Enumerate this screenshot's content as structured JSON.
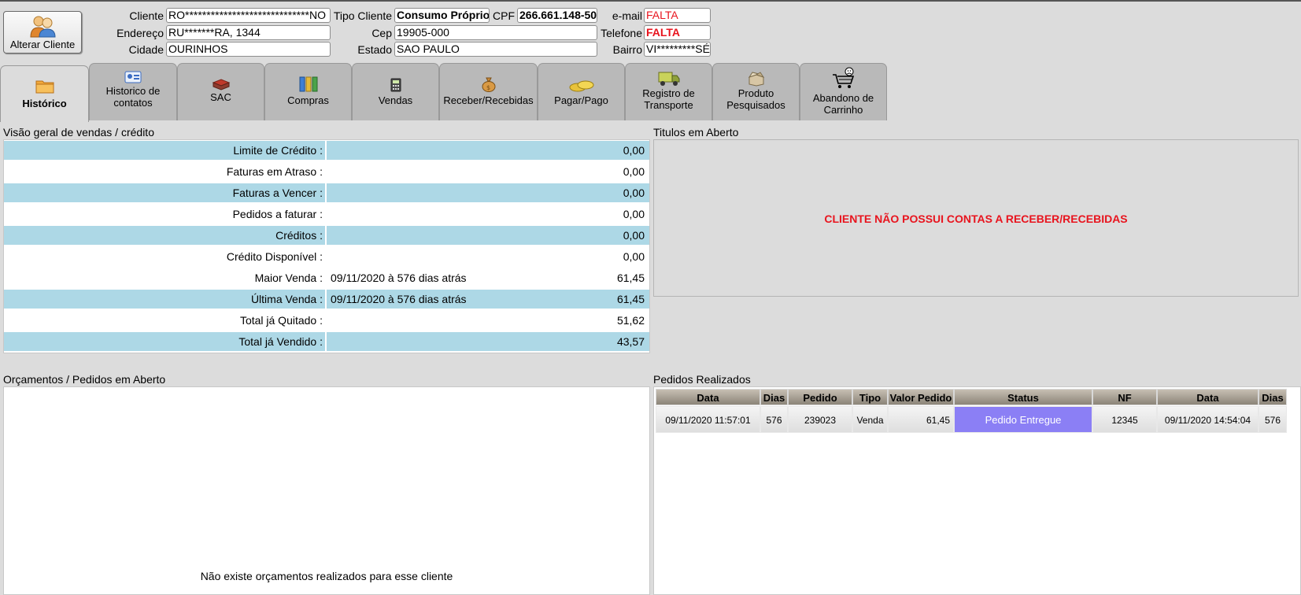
{
  "header": {
    "alter_button": "Alterar Cliente",
    "cliente_label": "Cliente",
    "cliente_value": "RO*****************************NO",
    "tipo_label": "Tipo Cliente",
    "tipo_value": "Consumo Próprio",
    "cpf_label": "CPF",
    "cpf_value": "266.661.148-50",
    "email_label": "e-mail",
    "email_value": "FALTA",
    "endereco_label": "Endereço",
    "endereco_value": "RU*******RA, 1344",
    "cep_label": "Cep",
    "cep_value": "19905-000",
    "telefone_label": "Telefone",
    "telefone_value": "FALTA",
    "cidade_label": "Cidade",
    "cidade_value": "OURINHOS",
    "estado_label": "Estado",
    "estado_value": "SAO PAULO",
    "bairro_label": "Bairro",
    "bairro_value": "VI*********SÉ"
  },
  "tabs": [
    {
      "label": "Histórico",
      "icon": "folder-icon"
    },
    {
      "label": "Historico de contatos",
      "icon": "contact-card-icon"
    },
    {
      "label": "SAC",
      "icon": "book-icon"
    },
    {
      "label": "Compras",
      "icon": "binders-icon"
    },
    {
      "label": "Vendas",
      "icon": "calculator-icon"
    },
    {
      "label": "Receber/Recebidas",
      "icon": "money-bag-icon"
    },
    {
      "label": "Pagar/Pago",
      "icon": "coins-icon"
    },
    {
      "label": "Registro de Transporte",
      "icon": "truck-icon"
    },
    {
      "label": "Produto Pesquisados",
      "icon": "open-box-icon"
    },
    {
      "label": "Abandono de Carrinho",
      "icon": "sad-cart-icon"
    }
  ],
  "overview": {
    "title": "Visão geral de vendas / crédito",
    "rows": [
      {
        "label": "Limite de Crédito :",
        "detail": "",
        "value": "0,00"
      },
      {
        "label": "Faturas em Atraso :",
        "detail": "",
        "value": "0,00"
      },
      {
        "label": "Faturas a Vencer :",
        "detail": "",
        "value": "0,00"
      },
      {
        "label": "Pedidos a faturar :",
        "detail": "",
        "value": "0,00"
      },
      {
        "label": "Créditos :",
        "detail": "",
        "value": "0,00"
      },
      {
        "label": "Crédito Disponível :",
        "detail": "",
        "value": "0,00"
      },
      {
        "label": "Maior Venda :",
        "detail": "09/11/2020 à 576 dias atrás",
        "value": "61,45"
      },
      {
        "label": "Última Venda :",
        "detail": "09/11/2020 à 576 dias atrás",
        "value": "61,45"
      },
      {
        "label": "Total já Quitado :",
        "detail": "",
        "value": "51,62"
      },
      {
        "label": "Total já Vendido :",
        "detail": "",
        "value": "43,57"
      }
    ]
  },
  "titulos": {
    "title": "Titulos em Aberto",
    "message": "CLIENTE NÃO POSSUI CONTAS A RECEBER/RECEBIDAS"
  },
  "orcamentos": {
    "title": "Orçamentos / Pedidos em Aberto",
    "message": "Não existe orçamentos realizados para esse cliente"
  },
  "pedidos": {
    "title": "Pedidos Realizados",
    "columns": [
      "Data",
      "Dias",
      "Pedido",
      "Tipo",
      "Valor Pedido",
      "Status",
      "NF",
      "Data",
      "Dias"
    ],
    "rows": [
      [
        "09/11/2020 11:57:01",
        "576",
        "239023",
        "Venda",
        "61,45",
        "Pedido Entregue",
        "12345",
        "09/11/2020 14:54:04",
        "576"
      ]
    ],
    "status_color": "#8b7ff5"
  },
  "colors": {
    "row_highlight": "#add8e6",
    "alert_red": "#e8141e",
    "background": "#dcdcdc"
  }
}
